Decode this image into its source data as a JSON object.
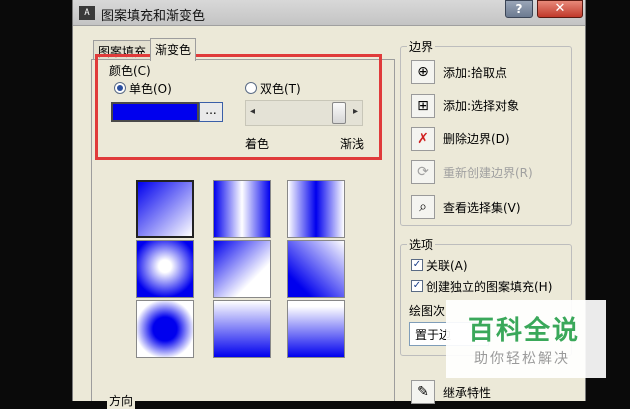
{
  "window": {
    "title": "图案填充和渐变色",
    "help_label": "?",
    "close_label": "✕"
  },
  "tabs": [
    {
      "label": "图案填充",
      "active": false
    },
    {
      "label": "渐变色",
      "active": true
    }
  ],
  "color": {
    "group_label": "颜色(C)",
    "single_label": "单色(O)",
    "double_label": "双色(T)",
    "single_selected": true,
    "swatch_color": "#0000ee",
    "browse_label": "...",
    "shade_label": "着色",
    "tint_label": "渐浅"
  },
  "direction": {
    "label": "方向"
  },
  "boundaries": {
    "label": "边界",
    "items": [
      {
        "label": "添加:拾取点",
        "enabled": true,
        "icon": "pick-points-icon"
      },
      {
        "label": "添加:选择对象",
        "enabled": true,
        "icon": "select-objects-icon"
      },
      {
        "label": "删除边界(D)",
        "enabled": true,
        "icon": "remove-boundary-icon"
      },
      {
        "label": "重新创建边界(R)",
        "enabled": false,
        "icon": "recreate-boundary-icon"
      },
      {
        "label": "查看选择集(V)",
        "enabled": true,
        "icon": "magnifier-icon"
      }
    ]
  },
  "options": {
    "label": "选项",
    "associative_label": "关联(A)",
    "associative_checked": true,
    "separate_label": "创建独立的图案填充(H)",
    "separate_checked": true,
    "draw_order_label": "绘图次",
    "draw_order_value": "置于边"
  },
  "inherit_label": "继承特性",
  "watermark": {
    "title": "百科全说",
    "subtitle": "助你轻松解决"
  }
}
